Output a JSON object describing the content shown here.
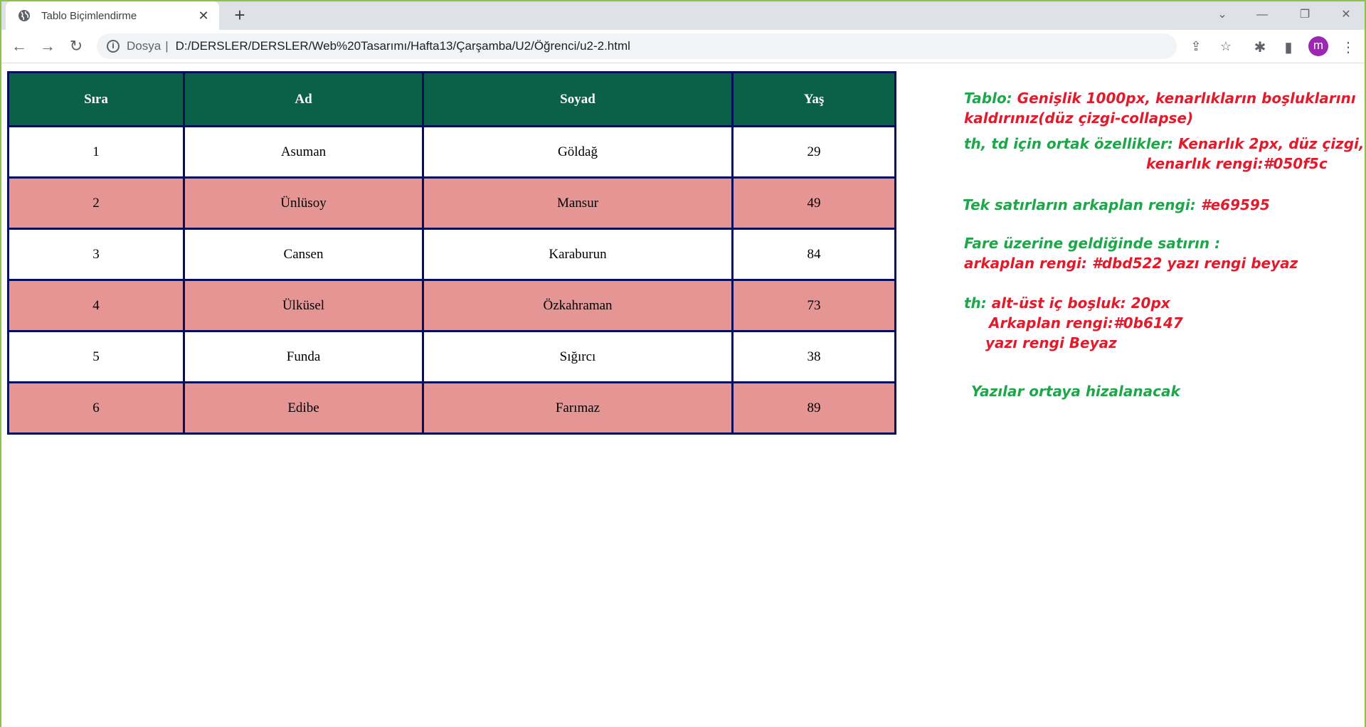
{
  "browser": {
    "tab_title": "Tablo Biçimlendirme",
    "address_scheme": "Dosya",
    "address_url": "D:/DERSLER/DERSLER/Web%20Tasarımı/Hafta13/Çarşamba/U2/Öğrenci/u2-2.html",
    "avatar_letter": "m"
  },
  "table": {
    "headers": [
      "Sıra",
      "Ad",
      "Soyad",
      "Yaş"
    ],
    "rows": [
      [
        "1",
        "Asuman",
        "Göldağ",
        "29"
      ],
      [
        "2",
        "Ünlüsoy",
        "Mansur",
        "49"
      ],
      [
        "3",
        "Cansen",
        "Karaburun",
        "84"
      ],
      [
        "4",
        "Ülküsel",
        "Özkahraman",
        "73"
      ],
      [
        "5",
        "Funda",
        "Sığırcı",
        "38"
      ],
      [
        "6",
        "Edibe",
        "Farımaz",
        "89"
      ]
    ]
  },
  "notes": {
    "n1_label": "Tablo:",
    "n1_text_a": "Genişlik 1000px, kenarlıkların boşluklarını",
    "n1_text_b": "kaldırınız(düz çizgi-collapse)",
    "n2_label": "th, td için ortak özellikler:",
    "n2_text_a": "Kenarlık 2px,  düz çizgi,",
    "n2_text_b": "kenarlık rengi:#050f5c",
    "n3_label": "Tek  satırların arkaplan rengi:",
    "n3_text": "#e69595",
    "n4_label": "Fare üzerine geldiğinde satırın :",
    "n4_text": "arkaplan rengi:  #dbd522 yazı rengi beyaz",
    "n5_label": "th:",
    "n5_text_a": "alt-üst iç boşluk: 20px",
    "n5_text_b": "Arkaplan rengi:#0b6147",
    "n5_text_c": "yazı rengi Beyaz",
    "n6_text": "Yazılar ortaya hizalanacak"
  },
  "colors": {
    "th_bg": "#0b6147",
    "border": "#050f5c",
    "odd_row_bg": "#e69595",
    "note_green": "#1fa64a",
    "note_red": "#e01b2b"
  }
}
